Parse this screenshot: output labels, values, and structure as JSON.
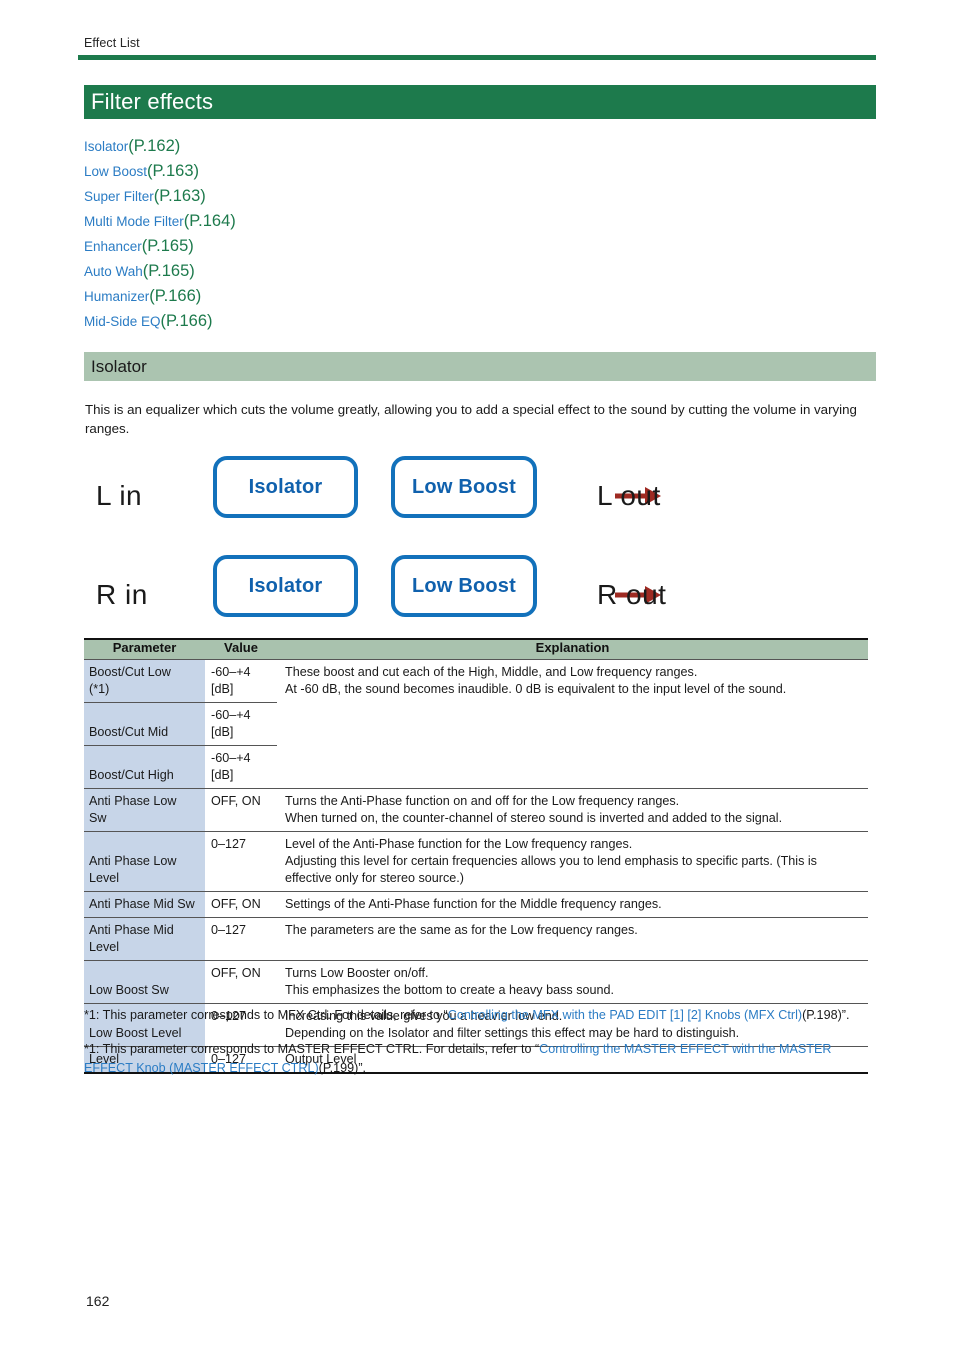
{
  "header": {
    "running_head": "Effect List",
    "title": "Filter effects",
    "accent_green": "#1d7a4c",
    "sage_green": "#abc4b0",
    "link_blue": "#2b7cc4"
  },
  "link_list": [
    {
      "name": "Isolator",
      "page": "(P.162)"
    },
    {
      "name": "Low Boost",
      "page": "(P.163)"
    },
    {
      "name": "Super Filter",
      "page": "(P.163)"
    },
    {
      "name": "Multi Mode Filter",
      "page": "(P.164)"
    },
    {
      "name": "Enhancer",
      "page": "(P.165)"
    },
    {
      "name": "Auto Wah",
      "page": "(P.165)"
    },
    {
      "name": "Humanizer",
      "page": "(P.166)"
    },
    {
      "name": "Mid-Side EQ",
      "page": "(P.166)"
    }
  ],
  "section": {
    "heading": "Isolator",
    "intro": "This is an equalizer which cuts the volume greatly, allowing you to add a special effect to the sound by cutting the volume in varying ranges."
  },
  "diagram": {
    "box_blue": "#1271bb",
    "wire_red": "#9e2a22",
    "chains": [
      {
        "input_label": "L in",
        "output_label": "L out",
        "blocks": [
          "Isolator",
          "Low Boost"
        ]
      },
      {
        "input_label": "R in",
        "output_label": "R out",
        "blocks": [
          "Isolator",
          "Low Boost"
        ]
      }
    ]
  },
  "table": {
    "headers": [
      "Parameter",
      "Value",
      "Explanation"
    ],
    "rows": [
      {
        "parameter_line1": "Boost/Cut Low",
        "parameter_line2": "(*1)",
        "value_line1": "-60–+4",
        "value_line2": "[dB]",
        "explanation_line1": "These boost and cut each of the High, Middle, and Low frequency ranges.",
        "explanation_line2": "At -60 dB, the sound becomes inaudible. 0 dB is equivalent to the input level of the sound."
      },
      {
        "parameter_line1": "Boost/Cut Mid",
        "value_line1": "-60–+4",
        "value_line2": "[dB]"
      },
      {
        "parameter_line1": "Boost/Cut High",
        "value_line1": "-60–+4",
        "value_line2": "[dB]"
      },
      {
        "parameter_line1": "Anti Phase Low",
        "parameter_line2": "Sw",
        "value_line1": "OFF, ON",
        "explanation_line1": "Turns the Anti-Phase function on and off for the Low frequency ranges.",
        "explanation_line2": "When turned on, the counter-channel of stereo sound is inverted and added to the signal."
      },
      {
        "parameter_line1": "Anti Phase Low",
        "parameter_line2": "Level",
        "value_line1": "0–127",
        "explanation_line1": "Level of the Anti-Phase function for the Low frequency ranges.",
        "explanation_line2": "Adjusting this level for certain frequencies allows you to lend emphasis to specific parts. (This is effective only for stereo source.)"
      },
      {
        "parameter_line1": "Anti Phase Mid Sw",
        "value_line1": "OFF, ON",
        "explanation_line1": "Settings of the Anti-Phase function for the Middle frequency ranges."
      },
      {
        "parameter_line1": "Anti Phase Mid",
        "parameter_line2": "Level",
        "value_line1": "0–127",
        "explanation_line1": "The parameters are the same as for the Low frequency ranges."
      },
      {
        "parameter_line1": "Low Boost Sw",
        "value_line1": "OFF, ON",
        "explanation_line1": "Turns Low Booster on/off.",
        "explanation_line2": "This emphasizes the bottom to create a heavy bass sound."
      },
      {
        "parameter_line1": "Low Boost Level",
        "value_line1": "0–127",
        "explanation_line1": "Increasing this value gives you a heavier low end.",
        "explanation_line2": "Depending on the Isolator and filter settings this effect may be hard to distinguish."
      },
      {
        "parameter_line1": "Level",
        "value_line1": "0–127",
        "explanation_line1": "Output Level"
      }
    ]
  },
  "footnotes": [
    {
      "lead": "*1: This parameter corresponds to MFX Ctrl. For details, refer to “",
      "link": "Controlling the MFX with the PAD EDIT [1] [2] Knobs (MFX Ctrl)",
      "tail": "(P.198)”."
    },
    {
      "lead": "*1: This parameter corresponds to MASTER EFFECT CTRL. For details, refer to “",
      "link": "Controlling the MASTER EFFECT with the MASTER EFFECT Knob (MASTER EFFECT CTRL)",
      "tail": "(P.199)”."
    }
  ],
  "page_number": "162"
}
